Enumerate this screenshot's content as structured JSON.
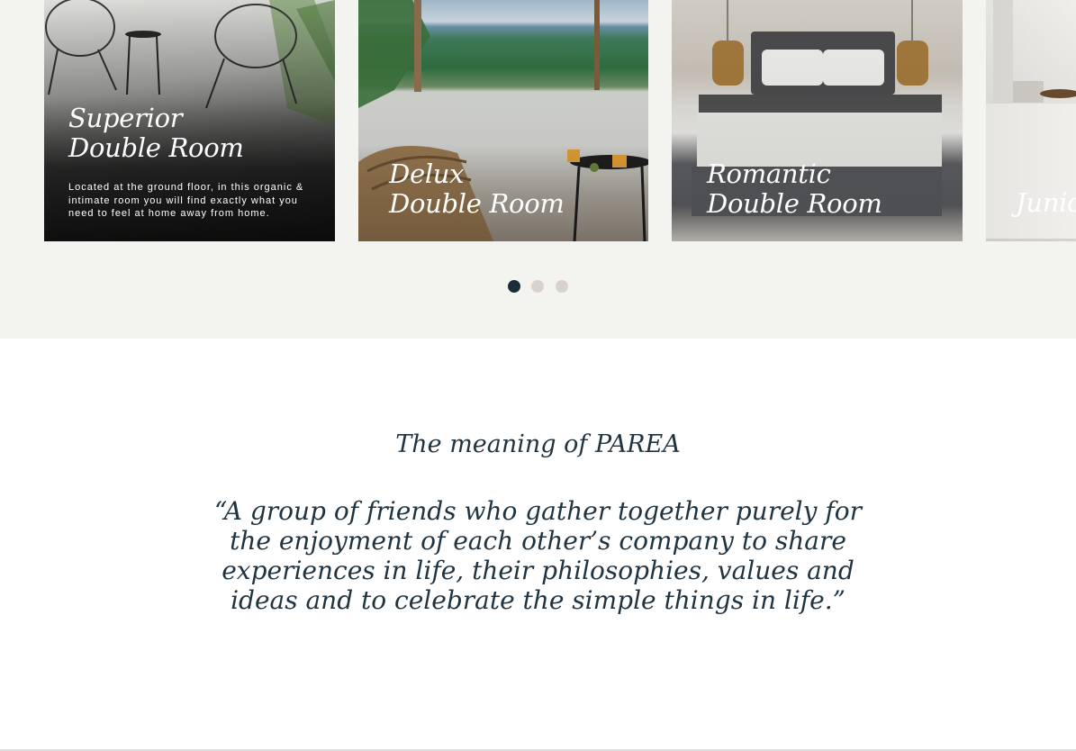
{
  "rooms": {
    "cards": [
      {
        "title_line1": "Superior",
        "title_line2": "Double Room",
        "description": "Located at the ground floor, in this organic & intimate room you will find exactly what you need to feel at home away from home."
      },
      {
        "title_line1": "Delux",
        "title_line2": "Double Room"
      },
      {
        "title_line1": "Romantic",
        "title_line2": "Double Room"
      },
      {
        "title_line1": "Junio"
      }
    ],
    "pagination": {
      "active_index": 1,
      "total": 3,
      "active_color": "#1c2d3a",
      "inactive_color": "#d9d2cc"
    }
  },
  "parea": {
    "heading": "The meaning of  PAREA",
    "quote_lines": [
      "“A group of friends who gather together purely for",
      "the enjoyment of each other’s company to share",
      "experiences in life, their philosophies, values and",
      "ideas and to celebrate the simple things in life.”"
    ]
  },
  "colors": {
    "section_background": "#f3f3ef",
    "text_dark": "#1f3340",
    "card_text": "#ffffff"
  }
}
